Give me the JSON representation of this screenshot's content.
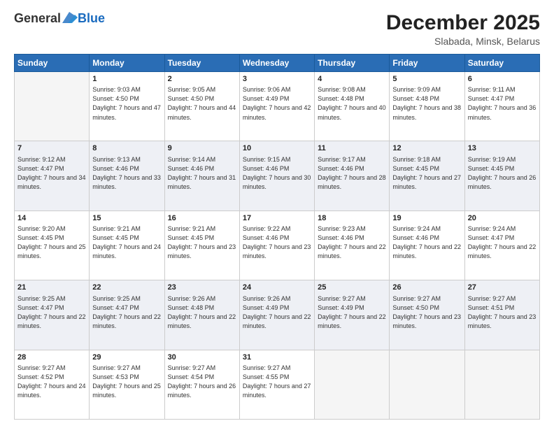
{
  "logo": {
    "general": "General",
    "blue": "Blue"
  },
  "title": "December 2025",
  "subtitle": "Slabada, Minsk, Belarus",
  "days_of_week": [
    "Sunday",
    "Monday",
    "Tuesday",
    "Wednesday",
    "Thursday",
    "Friday",
    "Saturday"
  ],
  "weeks": [
    {
      "shaded": false,
      "days": [
        {
          "num": "",
          "empty": true
        },
        {
          "num": "1",
          "sunrise": "9:03 AM",
          "sunset": "4:50 PM",
          "daylight": "7 hours and 47 minutes."
        },
        {
          "num": "2",
          "sunrise": "9:05 AM",
          "sunset": "4:50 PM",
          "daylight": "7 hours and 44 minutes."
        },
        {
          "num": "3",
          "sunrise": "9:06 AM",
          "sunset": "4:49 PM",
          "daylight": "7 hours and 42 minutes."
        },
        {
          "num": "4",
          "sunrise": "9:08 AM",
          "sunset": "4:48 PM",
          "daylight": "7 hours and 40 minutes."
        },
        {
          "num": "5",
          "sunrise": "9:09 AM",
          "sunset": "4:48 PM",
          "daylight": "7 hours and 38 minutes."
        },
        {
          "num": "6",
          "sunrise": "9:11 AM",
          "sunset": "4:47 PM",
          "daylight": "7 hours and 36 minutes."
        }
      ]
    },
    {
      "shaded": true,
      "days": [
        {
          "num": "7",
          "sunrise": "9:12 AM",
          "sunset": "4:47 PM",
          "daylight": "7 hours and 34 minutes."
        },
        {
          "num": "8",
          "sunrise": "9:13 AM",
          "sunset": "4:46 PM",
          "daylight": "7 hours and 33 minutes."
        },
        {
          "num": "9",
          "sunrise": "9:14 AM",
          "sunset": "4:46 PM",
          "daylight": "7 hours and 31 minutes."
        },
        {
          "num": "10",
          "sunrise": "9:15 AM",
          "sunset": "4:46 PM",
          "daylight": "7 hours and 30 minutes."
        },
        {
          "num": "11",
          "sunrise": "9:17 AM",
          "sunset": "4:46 PM",
          "daylight": "7 hours and 28 minutes."
        },
        {
          "num": "12",
          "sunrise": "9:18 AM",
          "sunset": "4:45 PM",
          "daylight": "7 hours and 27 minutes."
        },
        {
          "num": "13",
          "sunrise": "9:19 AM",
          "sunset": "4:45 PM",
          "daylight": "7 hours and 26 minutes."
        }
      ]
    },
    {
      "shaded": false,
      "days": [
        {
          "num": "14",
          "sunrise": "9:20 AM",
          "sunset": "4:45 PM",
          "daylight": "7 hours and 25 minutes."
        },
        {
          "num": "15",
          "sunrise": "9:21 AM",
          "sunset": "4:45 PM",
          "daylight": "7 hours and 24 minutes."
        },
        {
          "num": "16",
          "sunrise": "9:21 AM",
          "sunset": "4:45 PM",
          "daylight": "7 hours and 23 minutes."
        },
        {
          "num": "17",
          "sunrise": "9:22 AM",
          "sunset": "4:46 PM",
          "daylight": "7 hours and 23 minutes."
        },
        {
          "num": "18",
          "sunrise": "9:23 AM",
          "sunset": "4:46 PM",
          "daylight": "7 hours and 22 minutes."
        },
        {
          "num": "19",
          "sunrise": "9:24 AM",
          "sunset": "4:46 PM",
          "daylight": "7 hours and 22 minutes."
        },
        {
          "num": "20",
          "sunrise": "9:24 AM",
          "sunset": "4:47 PM",
          "daylight": "7 hours and 22 minutes."
        }
      ]
    },
    {
      "shaded": true,
      "days": [
        {
          "num": "21",
          "sunrise": "9:25 AM",
          "sunset": "4:47 PM",
          "daylight": "7 hours and 22 minutes."
        },
        {
          "num": "22",
          "sunrise": "9:25 AM",
          "sunset": "4:47 PM",
          "daylight": "7 hours and 22 minutes."
        },
        {
          "num": "23",
          "sunrise": "9:26 AM",
          "sunset": "4:48 PM",
          "daylight": "7 hours and 22 minutes."
        },
        {
          "num": "24",
          "sunrise": "9:26 AM",
          "sunset": "4:49 PM",
          "daylight": "7 hours and 22 minutes."
        },
        {
          "num": "25",
          "sunrise": "9:27 AM",
          "sunset": "4:49 PM",
          "daylight": "7 hours and 22 minutes."
        },
        {
          "num": "26",
          "sunrise": "9:27 AM",
          "sunset": "4:50 PM",
          "daylight": "7 hours and 23 minutes."
        },
        {
          "num": "27",
          "sunrise": "9:27 AM",
          "sunset": "4:51 PM",
          "daylight": "7 hours and 23 minutes."
        }
      ]
    },
    {
      "shaded": false,
      "days": [
        {
          "num": "28",
          "sunrise": "9:27 AM",
          "sunset": "4:52 PM",
          "daylight": "7 hours and 24 minutes."
        },
        {
          "num": "29",
          "sunrise": "9:27 AM",
          "sunset": "4:53 PM",
          "daylight": "7 hours and 25 minutes."
        },
        {
          "num": "30",
          "sunrise": "9:27 AM",
          "sunset": "4:54 PM",
          "daylight": "7 hours and 26 minutes."
        },
        {
          "num": "31",
          "sunrise": "9:27 AM",
          "sunset": "4:55 PM",
          "daylight": "7 hours and 27 minutes."
        },
        {
          "num": "",
          "empty": true
        },
        {
          "num": "",
          "empty": true
        },
        {
          "num": "",
          "empty": true
        }
      ]
    }
  ]
}
